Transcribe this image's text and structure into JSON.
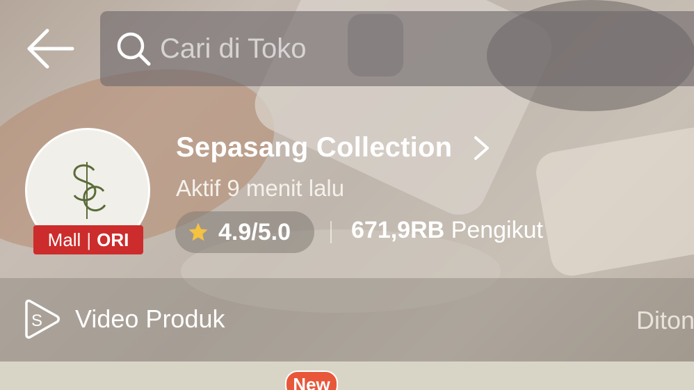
{
  "header": {
    "search_placeholder": "Cari di Toko"
  },
  "shop": {
    "name": "Sepasang Collection",
    "active_status": "Aktif 9 menit lalu",
    "rating": "4.9/5.0",
    "followers_count": "671,9RB",
    "followers_label": "Pengikut",
    "badge": {
      "mall": "Mall",
      "ori": "ORI"
    }
  },
  "strip": {
    "video_label": "Video Produk",
    "right_label": "Ditonton"
  },
  "tabs": {
    "new_badge": "New"
  },
  "colors": {
    "badge_red": "#cc2c2b",
    "star_yellow": "#f5c242",
    "new_orange": "#e8573a",
    "logo_green": "#5a6b3a"
  },
  "icons": [
    "back-arrow-icon",
    "search-icon",
    "chevron-right-icon",
    "star-icon",
    "video-play-icon"
  ]
}
